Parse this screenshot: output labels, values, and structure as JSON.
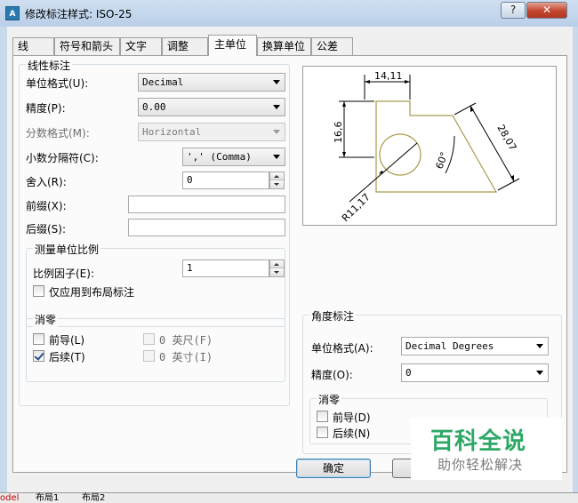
{
  "window": {
    "title": "修改标注样式: ISO-25",
    "icon_text": "A",
    "help_glyph": "?",
    "close_glyph": "✕"
  },
  "tabs": [
    "线",
    "符号和箭头",
    "文字",
    "调整",
    "主单位",
    "换算单位",
    "公差"
  ],
  "active_tab": 4,
  "linear": {
    "title": "线性标注",
    "unit_format_label": "单位格式(U):",
    "unit_format_value": "Decimal",
    "precision_label": "精度(P):",
    "precision_value": "0.00",
    "fraction_label": "分数格式(M):",
    "fraction_value": "Horizontal",
    "decimal_sep_label": "小数分隔符(C):",
    "decimal_sep_value": "','  (Comma)",
    "round_label": "舍入(R):",
    "round_value": "0",
    "prefix_label": "前缀(X):",
    "prefix_value": "",
    "suffix_label": "后缀(S):",
    "suffix_value": ""
  },
  "scale": {
    "title": "测量单位比例",
    "factor_label": "比例因子(E):",
    "factor_value": "1",
    "layout_only_label": "仅应用到布局标注",
    "layout_only_checked": false
  },
  "zero_linear": {
    "title": "消零",
    "leading_label": "前导(L)",
    "leading_checked": false,
    "trailing_label": "后续(T)",
    "trailing_checked": true,
    "feet_label": "0 英尺(F)",
    "inches_label": "0 英寸(I)"
  },
  "angular": {
    "title": "角度标注",
    "unit_format_label": "单位格式(A):",
    "unit_format_value": "Decimal Degrees",
    "precision_label": "精度(O):",
    "precision_value": "0"
  },
  "zero_angular": {
    "title": "消零",
    "leading_label": "前导(D)",
    "leading_checked": false,
    "trailing_label": "后续(N)",
    "trailing_checked": false
  },
  "preview": {
    "dim_top": "14,11",
    "dim_left": "16,6",
    "dim_right": "28,07",
    "dim_angle": "60°",
    "dim_radius": "R11,17"
  },
  "buttons": {
    "ok": "确定"
  },
  "watermark": {
    "title": "百科全说",
    "subtitle": "助你轻松解决"
  },
  "layout_tabs": [
    "odel",
    "布局1",
    "布局2"
  ],
  "colors": {
    "preview_line": "#a89a4a",
    "dim_line": "#000000",
    "watermark_green": "#2ea866"
  }
}
